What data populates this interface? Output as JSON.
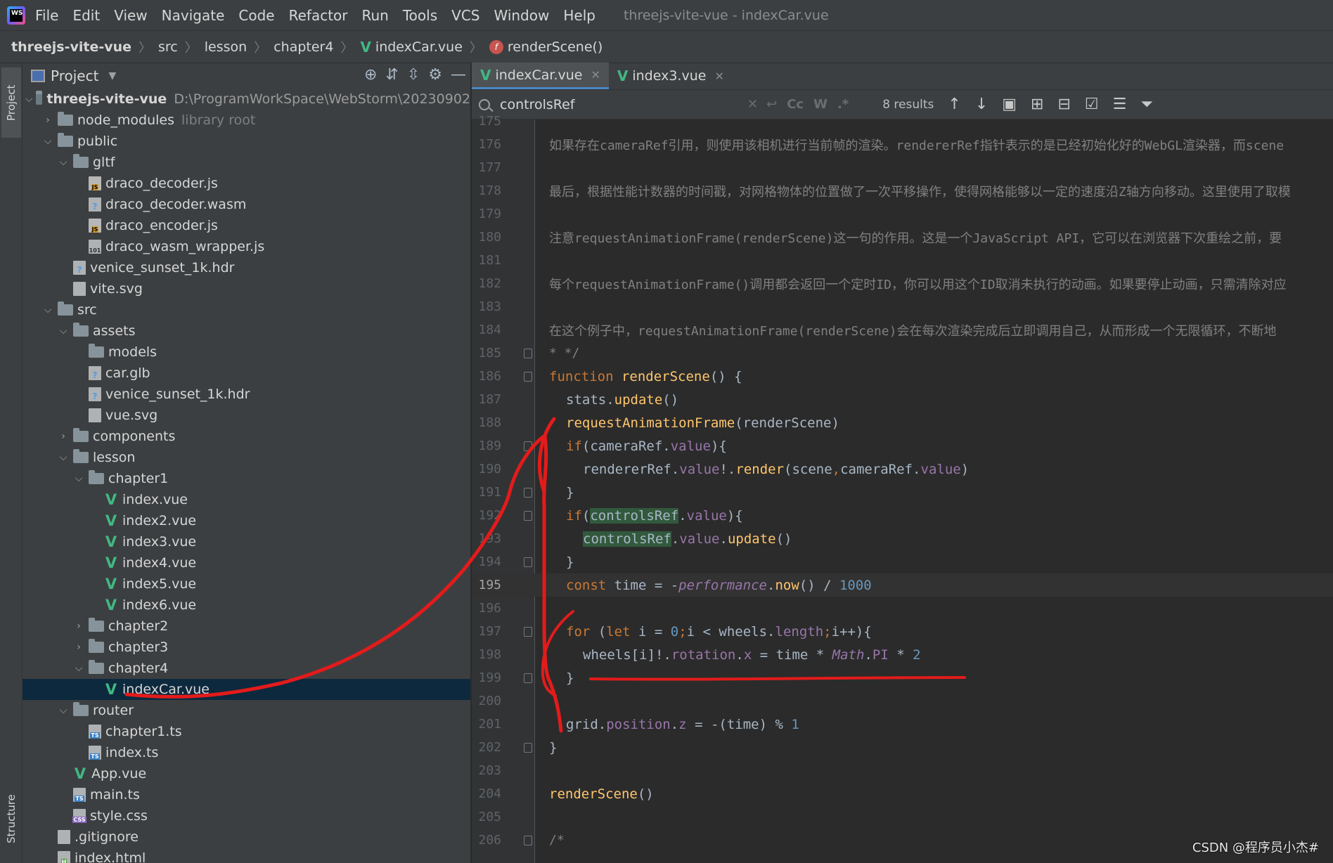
{
  "menu": {
    "items": [
      "File",
      "Edit",
      "View",
      "Navigate",
      "Code",
      "Refactor",
      "Run",
      "Tools",
      "VCS",
      "Window",
      "Help"
    ],
    "title": "threejs-vite-vue - indexCar.vue"
  },
  "breadcrumb": [
    "threejs-vite-vue",
    "src",
    "lesson",
    "chapter4",
    "indexCar.vue",
    "renderScene()"
  ],
  "toolstrip": {
    "project": "Project",
    "structure": "Structure"
  },
  "project": {
    "title": "Project",
    "root_name": "threejs-vite-vue",
    "root_path": "D:\\ProgramWorkSpace\\WebStorm\\20230902",
    "node_modules": "node_modules",
    "library_root": "library root",
    "public": "public",
    "gltf": "gltf",
    "draco_decoder_js": "draco_decoder.js",
    "draco_decoder_wasm": "draco_decoder.wasm",
    "draco_encoder_js": "draco_encoder.js",
    "draco_wasm_wrapper_js": "draco_wasm_wrapper.js",
    "venice_hdr_public": "venice_sunset_1k.hdr",
    "vite_svg": "vite.svg",
    "src": "src",
    "assets": "assets",
    "models": "models",
    "car_glb": "car.glb",
    "venice_hdr_assets": "venice_sunset_1k.hdr",
    "vue_svg": "vue.svg",
    "components": "components",
    "lesson": "lesson",
    "chapter1": "chapter1",
    "index_vue": "index.vue",
    "index2_vue": "index2.vue",
    "index3_vue": "index3.vue",
    "index4_vue": "index4.vue",
    "index5_vue": "index5.vue",
    "index6_vue": "index6.vue",
    "chapter2": "chapter2",
    "chapter3": "chapter3",
    "chapter4": "chapter4",
    "indexCar_vue": "indexCar.vue",
    "router": "router",
    "chapter1_ts": "chapter1.ts",
    "index_ts": "index.ts",
    "app_vue": "App.vue",
    "main_ts": "main.ts",
    "style_css": "style.css",
    "gitignore": ".gitignore",
    "index_html": "index.html"
  },
  "tabs": [
    {
      "label": "indexCar.vue",
      "active": true
    },
    {
      "label": "index3.vue",
      "active": false
    }
  ],
  "find": {
    "query": "controlsRef",
    "results": "8 results",
    "opt_case": "Cc",
    "opt_word": "W",
    "opt_regex": ".*"
  },
  "code": {
    "ln175": "175",
    "ln176": "176",
    "ln177": "177",
    "ln178": "178",
    "ln179": "179",
    "ln180": "180",
    "ln181": "181",
    "ln182": "182",
    "ln183": "183",
    "ln184": "184",
    "ln185": "185",
    "ln186": "186",
    "ln187": "187",
    "ln188": "188",
    "ln189": "189",
    "ln190": "190",
    "ln191": "191",
    "ln192": "192",
    "ln193": "193",
    "ln194": "194",
    "ln195": "195",
    "ln196": "196",
    "ln197": "197",
    "ln198": "198",
    "ln199": "199",
    "ln200": "200",
    "ln201": "201",
    "ln202": "202",
    "ln203": "203",
    "ln204": "204",
    "ln205": "205",
    "ln206": "206",
    "c176": "如果存在cameraRef引用，则使用该相机进行当前帧的渲染。rendererRef指针表示的是已经初始化好的WebGL渲染器，而scene",
    "c178": "最后，根据性能计数器的时间戳，对网格物体的位置做了一次平移操作，使得网格能够以一定的速度沿Z轴方向移动。这里使用了取模",
    "c180": "注意requestAnimationFrame(renderScene)这一句的作用。这是一个JavaScript API，它可以在浏览器下次重绘之前，要",
    "c182": "每个requestAnimationFrame()调用都会返回一个定时ID，你可以用这个ID取消未执行的动画。如果要停止动画，只需清除对应",
    "c184": "在这个例子中，requestAnimationFrame(renderScene)会在每次渲染完成后立即调用自己，从而形成一个无限循环，不断地",
    "c185": "* */",
    "t186_kw": "function",
    "t186_fn": "renderScene",
    "t186_rest": "() {",
    "t187_a": "stats.",
    "t187_fn": "update",
    "t187_b": "()",
    "t188_fn": "requestAnimationFrame",
    "t188_rest": "(renderScene)",
    "t189_kw": "if",
    "t189_a": "(cameraRef.",
    "t189_prop": "value",
    "t189_b": "){",
    "t190_a": "rendererRef.",
    "t190_prop": "value",
    "t190_b": "!.",
    "t190_fn": "render",
    "t190_c": "(scene",
    "t190_comma": ",",
    "t190_d": "cameraRef.",
    "t190_prop2": "value",
    "t190_e": ")",
    "t191": "}",
    "t192_kw": "if",
    "t192_a": "(",
    "t192_hl": "controlsRef",
    "t192_b": ".",
    "t192_prop": "value",
    "t192_c": "){",
    "t193_hl": "controlsRef",
    "t193_a": ".",
    "t193_prop": "value",
    "t193_b": ".",
    "t193_fn": "update",
    "t193_c": "()",
    "t194": "}",
    "t195_kw": "const",
    "t195_a": " time = -",
    "t195_it": "performance",
    "t195_b": ".",
    "t195_fn": "now",
    "t195_c": "() / ",
    "t195_num": "1000",
    "t197_kw": "for",
    "t197_a": " (",
    "t197_kw2": "let",
    "t197_b": " i = ",
    "t197_num": "0",
    "t197_semi": ";",
    "t197_c": "i < wheels.",
    "t197_prop": "length",
    "t197_semi2": ";",
    "t197_d": "i++){",
    "t198_a": "wheels[i]!.",
    "t198_prop": "rotation",
    "t198_b": ".",
    "t198_prop2": "x",
    "t198_c": " = time * ",
    "t198_it": "Math",
    "t198_d": ".",
    "t198_prop3": "PI",
    "t198_e": " * ",
    "t198_num": "2",
    "t199": "}",
    "t201_a": "grid.",
    "t201_prop": "position",
    "t201_b": ".",
    "t201_prop2": "z",
    "t201_c": " = -(time) % ",
    "t201_num": "1",
    "t202": "}",
    "t204_fn": "renderScene",
    "t204_a": "()",
    "t206": "/*"
  },
  "watermark": "CSDN @程序员小杰#",
  "colors": {
    "annotation": "#e31b1b",
    "vue": "#41b883",
    "selection": "#0d293e"
  }
}
